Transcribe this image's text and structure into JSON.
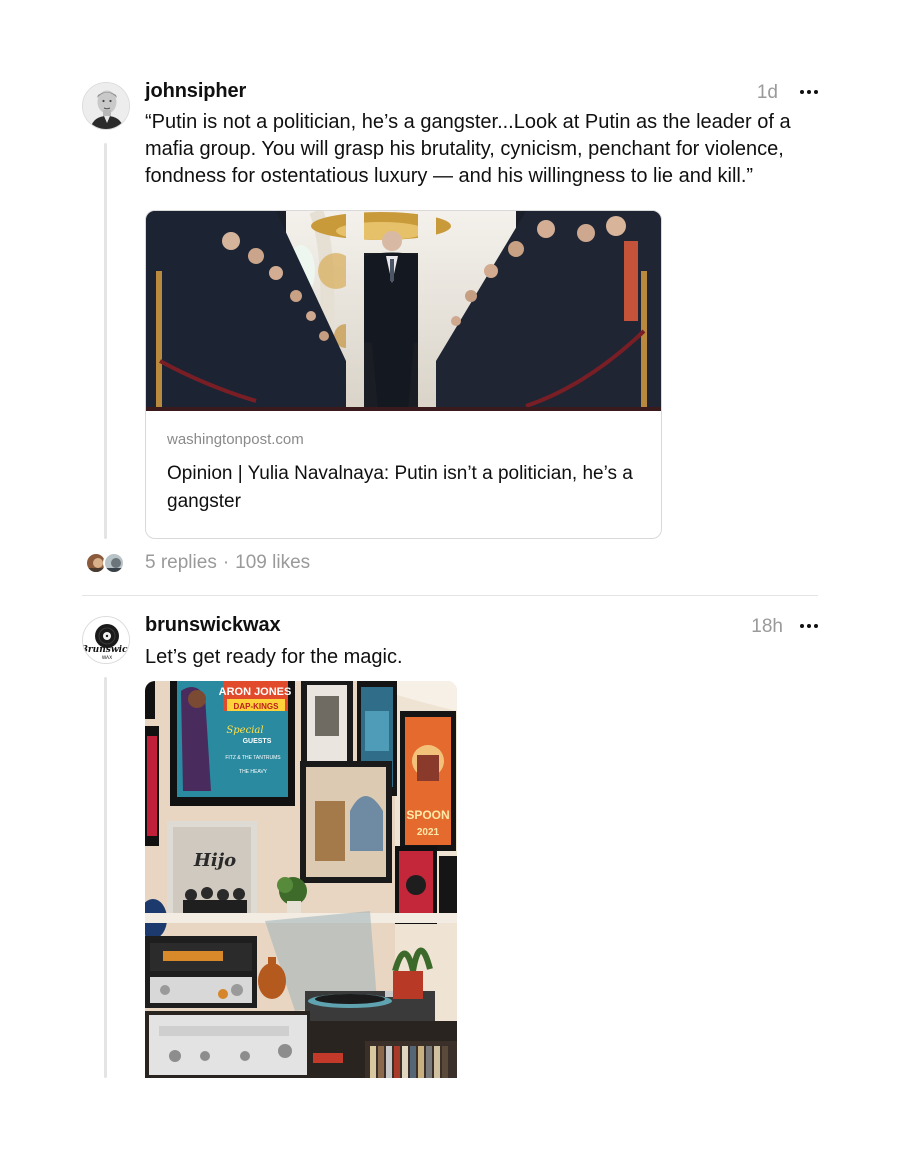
{
  "posts": [
    {
      "username": "johnsipher",
      "time": "1d",
      "text": "“Putin is not a politician, he’s a gangster...Look at Putin as the leader of a mafia group. You will grasp his brutality, cynicism, penchant for violence, fondness for ostentatious luxury — and his willingness to lie and kill.”",
      "link_card": {
        "domain": "washingtonpost.com",
        "headline": "Opinion | Yulia Navalnaya: Putin isn’t a politician, he’s a gangster"
      },
      "replies": "5 replies",
      "separator": "·",
      "likes": "109 likes"
    },
    {
      "username": "brunswickwax",
      "time": "18h",
      "text": "Let’s get ready for the magic.",
      "avatar_logo": {
        "main": "Brunswick",
        "sub": "WAX"
      },
      "photo_text": {
        "poster_top": "ARON JONES",
        "poster_band": "DAP-KINGS",
        "poster_special": "Special",
        "poster_guests": "GUESTS",
        "poster_lineup": "FITZ & THE TANTRUMS",
        "poster_lineup2": "THE HEAVY",
        "album": "Hijo",
        "spoon": "SPOON",
        "spoon_year": "2021"
      }
    }
  ],
  "colors": {
    "text": "#101010",
    "muted": "#9a9a9a",
    "border": "#d9d9d9",
    "line": "#e4e4e4"
  }
}
